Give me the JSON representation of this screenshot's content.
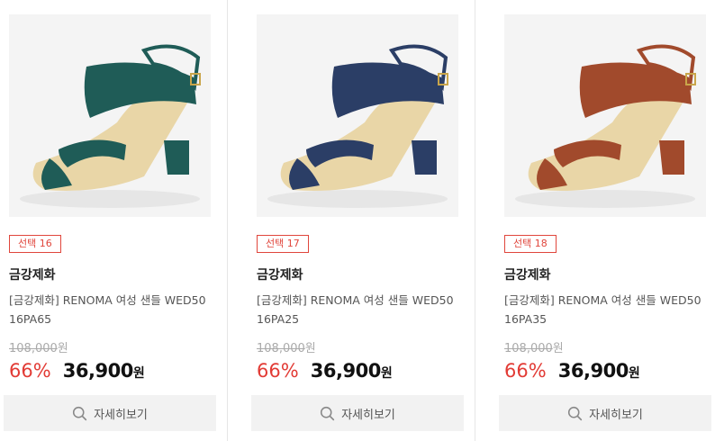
{
  "products": [
    {
      "badge": "선택 16",
      "brand": "금강제화",
      "name": "[금강제화] RENOMA 여성 샌들 WED50 16PA65",
      "original_price": "108,000",
      "original_currency": "원",
      "discount": "66%",
      "price": "36,900",
      "currency": "원",
      "button_label": "자세히보기",
      "image_icon": "sandal-green-image",
      "color": "#1f5c57"
    },
    {
      "badge": "선택 17",
      "brand": "금강제화",
      "name": "[금강제화] RENOMA 여성 샌들 WED50 16PA25",
      "original_price": "108,000",
      "original_currency": "원",
      "discount": "66%",
      "price": "36,900",
      "currency": "원",
      "button_label": "자세히보기",
      "image_icon": "sandal-navy-image",
      "color": "#2b3e66"
    },
    {
      "badge": "선택 18",
      "brand": "금강제화",
      "name": "[금강제화] RENOMA 여성 샌들 WED50 16PA35",
      "original_price": "108,000",
      "original_currency": "원",
      "discount": "66%",
      "price": "36,900",
      "currency": "원",
      "button_label": "자세히보기",
      "image_icon": "sandal-brown-image",
      "color": "#a14a2c"
    }
  ],
  "accent_color": "#e23b35",
  "search_icon": "search-icon"
}
